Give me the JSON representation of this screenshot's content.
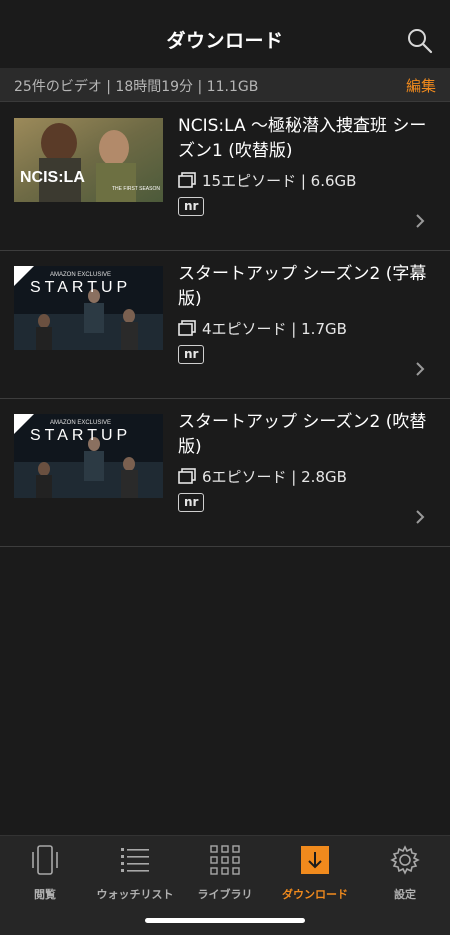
{
  "header": {
    "title": "ダウンロード",
    "search_icon": "search-icon"
  },
  "summary": {
    "text": "25件のビデオ | 18時間19分 | 11.1GB",
    "edit_label": "編集"
  },
  "items": [
    {
      "title": "NCIS:LA 〜極秘潜入捜査班 シーズン1 (吹替版)",
      "meta": "15エピソード | 6.6GB",
      "rating": "nr",
      "thumb_text": "NCIS:LA",
      "thumb_subtitle": "THE FIRST SEASON"
    },
    {
      "title": "スタートアップ シーズン2 (字幕版)",
      "meta": "4エピソード | 1.7GB",
      "rating": "nr",
      "thumb_top": "AMAZON EXCLUSIVE",
      "thumb_text": "STARTUP",
      "badge": "prime"
    },
    {
      "title": "スタートアップ シーズン2 (吹替版)",
      "meta": "6エピソード | 2.8GB",
      "rating": "nr",
      "thumb_top": "AMAZON EXCLUSIVE",
      "thumb_text": "STARTUP",
      "badge": "prime"
    }
  ],
  "tabs": [
    {
      "label": "閲覧",
      "icon": "phone-icon"
    },
    {
      "label": "ウォッチリスト",
      "icon": "list-icon"
    },
    {
      "label": "ライブラリ",
      "icon": "grid-icon"
    },
    {
      "label": "ダウンロード",
      "icon": "download-icon"
    },
    {
      "label": "設定",
      "icon": "gear-icon"
    }
  ],
  "colors": {
    "accent": "#f08a1d",
    "background": "#1b1b1b",
    "summary_bg": "#2b2b2b",
    "tabbar_bg": "#262626"
  }
}
